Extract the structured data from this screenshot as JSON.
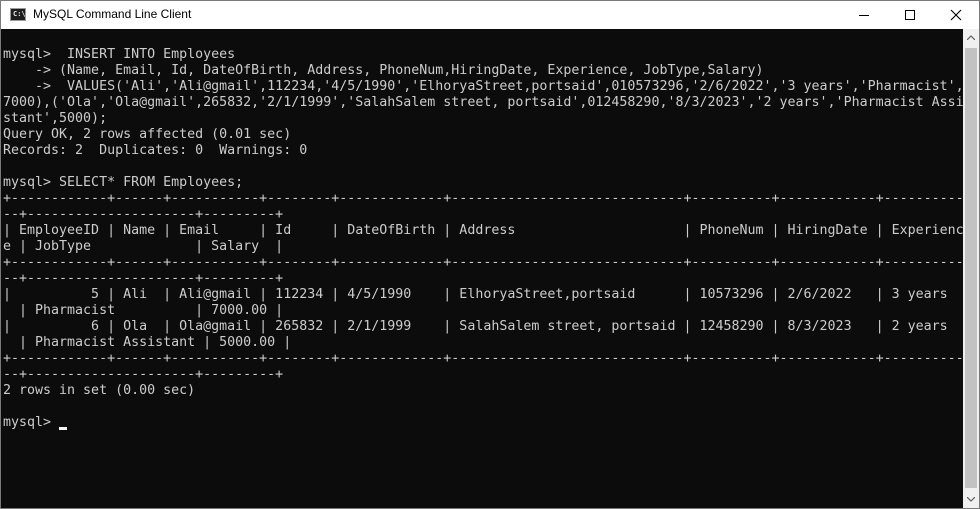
{
  "window": {
    "title": "MySQL Command Line Client",
    "icon": "console-icon",
    "icon_glyph": "C:\\"
  },
  "console": {
    "lines": [
      "",
      "mysql>  INSERT INTO Employees",
      "    -> (Name, Email, Id, DateOfBirth, Address, PhoneNum,HiringDate, Experience, JobType,Salary)",
      "    ->  VALUES('Ali','Ali@gmail',112234,'4/5/1990','ElhoryaStreet,portsaid',010573296,'2/6/2022','3 years','Pharmacist',",
      "7000),('Ola','Ola@gmail',265832,'2/1/1999','SalahSalem street, portsaid',012458290,'8/3/2023','2 years','Pharmacist Assi",
      "stant',5000);",
      "Query OK, 2 rows affected (0.01 sec)",
      "Records: 2  Duplicates: 0  Warnings: 0",
      "",
      "mysql> SELECT* FROM Employees;",
      "+------------+------+-----------+--------+-------------+-----------------------------+----------+------------+-----------",
      "--+---------------------+---------+",
      "| EmployeeID | Name | Email     | Id     | DateOfBirth | Address                     | PhoneNum | HiringDate | Experienc",
      "e | JobType             | Salary  |",
      "+------------+------+-----------+--------+-------------+-----------------------------+----------+------------+-----------",
      "--+---------------------+---------+",
      "|          5 | Ali  | Ali@gmail | 112234 | 4/5/1990    | ElhoryaStreet,portsaid      | 10573296 | 2/6/2022   | 3 years",
      "  | Pharmacist          | 7000.00 |",
      "|          6 | Ola  | Ola@gmail | 265832 | 2/1/1999    | SalahSalem street, portsaid | 12458290 | 8/3/2023   | 2 years",
      "  | Pharmacist Assistant | 5000.00 |",
      "+------------+------+-----------+--------+-------------+-----------------------------+----------+------------+-----------",
      "--+---------------------+---------+",
      "2 rows in set (0.00 sec)",
      "",
      "mysql> "
    ]
  }
}
